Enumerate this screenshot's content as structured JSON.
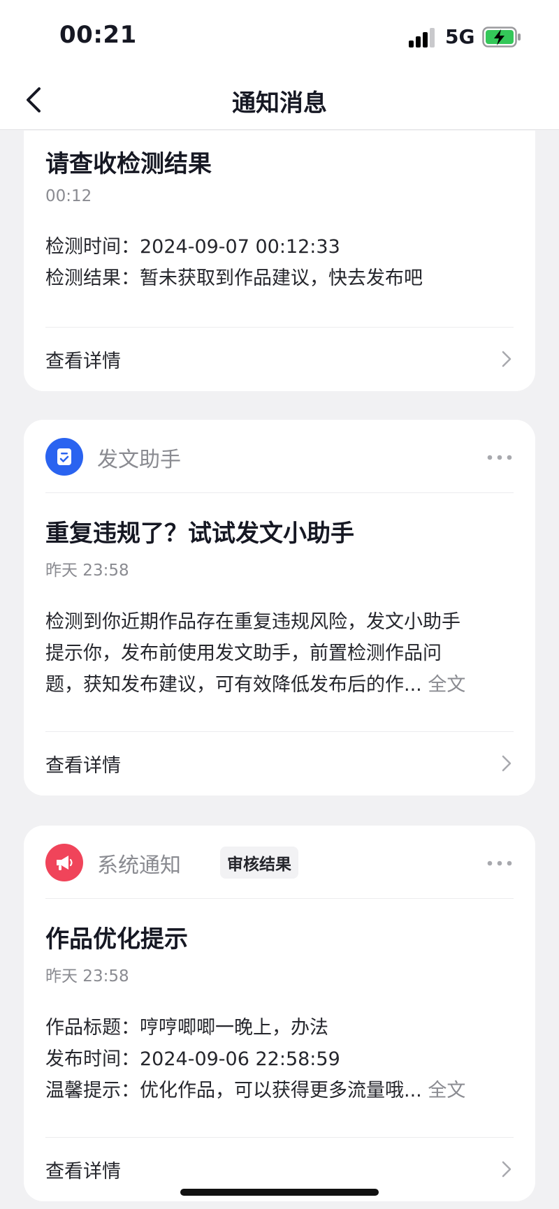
{
  "status_bar": {
    "time": "00:21",
    "network": "5G"
  },
  "nav": {
    "title": "通知消息"
  },
  "cards": [
    {
      "title": "请查收检测结果",
      "time": "00:12",
      "lines": [
        "检测时间：2024-09-07 00:12:33",
        "检测结果：暂未获取到作品建议，快去发布吧"
      ],
      "footer": "查看详情"
    },
    {
      "sender": "发文助手",
      "title": "重复违规了？试试发文小助手",
      "time": "昨天 23:58",
      "lines": [
        "检测到你近期作品存在重复违规风险，发文小助手",
        "提示你，发布前使用发文助手，前置检测作品问",
        "题，获知发布建议，可有效降低发布后的作..."
      ],
      "full_text": "全文",
      "footer": "查看详情"
    },
    {
      "sender": "系统通知",
      "tag": "审核结果",
      "title": "作品优化提示",
      "time": "昨天 23:58",
      "lines": [
        "作品标题：哼哼唧唧一晚上，办法",
        "发布时间：2024-09-06 22:58:59",
        "温馨提示：优化作品，可以获得更多流量哦..."
      ],
      "full_text": "全文",
      "footer": "查看详情"
    }
  ],
  "colors": {
    "assistant_icon_bg": "#2a63f0",
    "system_icon_bg": "#f0445a",
    "battery_fill": "#34c759"
  },
  "icons": {
    "assistant": "document-check-icon",
    "system": "megaphone-icon"
  }
}
